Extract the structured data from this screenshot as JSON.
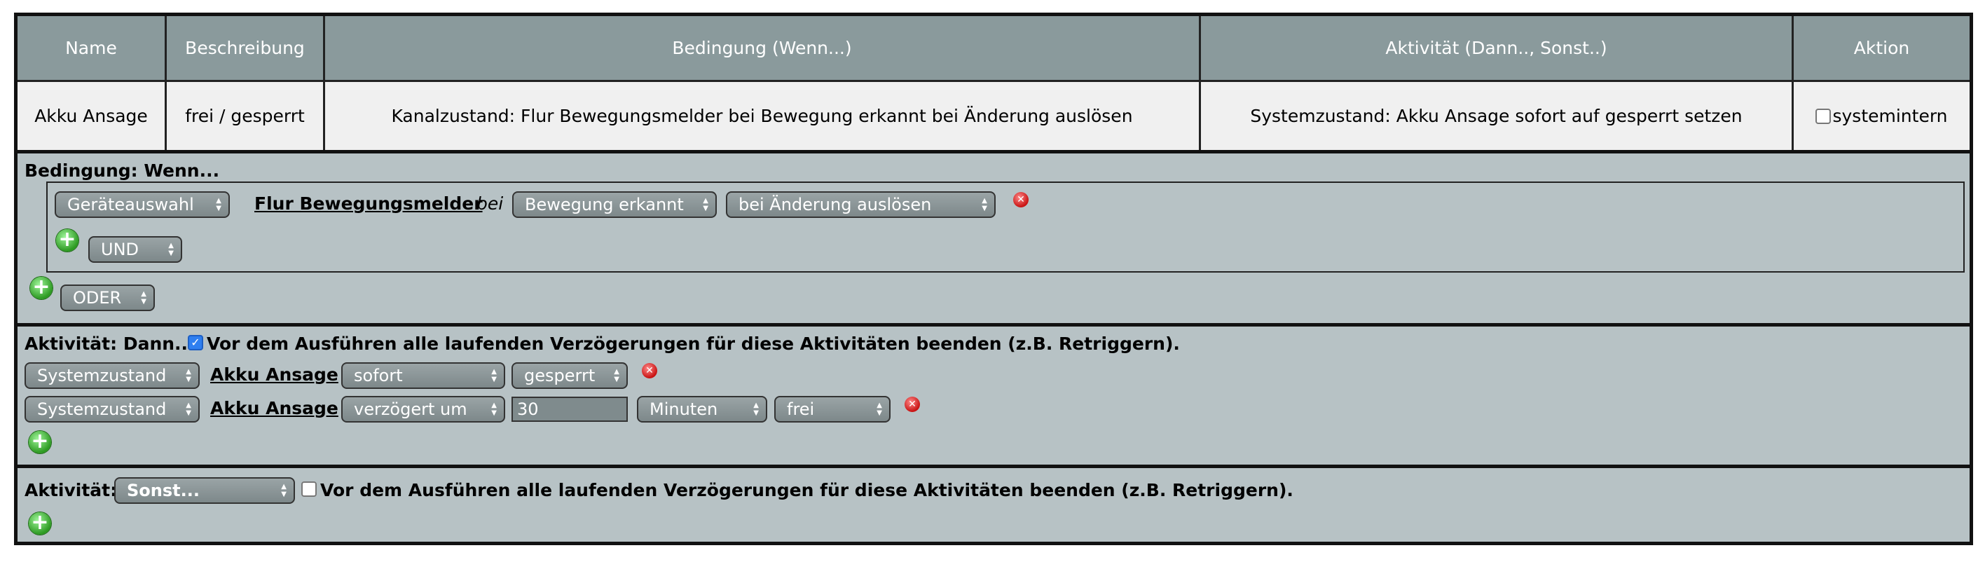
{
  "table": {
    "headers": [
      "Name",
      "Beschreibung",
      "Bedingung (Wenn...)",
      "Aktivität (Dann.., Sonst..)",
      "Aktion"
    ],
    "row": {
      "name": "Akku Ansage",
      "beschreibung": "frei / gesperrt",
      "bedingung": "Kanalzustand: Flur Bewegungsmelder bei Bewegung erkannt bei Änderung auslösen",
      "aktivitaet": "Systemzustand: Akku Ansage sofort auf gesperrt setzen",
      "aktion_label": "systemintern",
      "aktion_checked": false
    }
  },
  "condition": {
    "title": "Bedingung: Wenn...",
    "device_select": "Geräteauswahl",
    "device_link": "Flur Bewegungsmelder",
    "bei": "bei",
    "event_select": "Bewegung erkannt",
    "trigger_select": "bei Änderung auslösen",
    "und_select": "UND",
    "oder_select": "ODER"
  },
  "then": {
    "title": "Aktivität: Dann...",
    "retrigger_checked": true,
    "retrigger_label": "Vor dem Ausführen alle laufenden Verzögerungen für diese Aktivitäten beenden (z.B. Retriggern).",
    "rows": [
      {
        "type": "Systemzustand",
        "link": "Akku Ansage",
        "timing": "sofort",
        "value": "gesperrt"
      },
      {
        "type": "Systemzustand",
        "link": "Akku Ansage",
        "timing": "verzögert um",
        "delay": "30",
        "unit": "Minuten",
        "value": "frei"
      }
    ]
  },
  "else": {
    "title": "Aktivität:",
    "mode_select": "Sonst...",
    "retrigger_checked": false,
    "retrigger_label": "Vor dem Ausführen alle laufenden Verzögerungen für diese Aktivitäten beenden (z.B. Retriggern)."
  },
  "icons": {
    "add": "add-plus-icon",
    "delete": "delete-x-icon",
    "select_arrows": "updown-arrows-icon"
  },
  "colors": {
    "header_bg": "#8a9a9c",
    "panel_bg": "#b7c2c5",
    "add_green": "#2d9a22",
    "delete_red": "#c81212",
    "checkbox_blue": "#2f7ff0"
  }
}
